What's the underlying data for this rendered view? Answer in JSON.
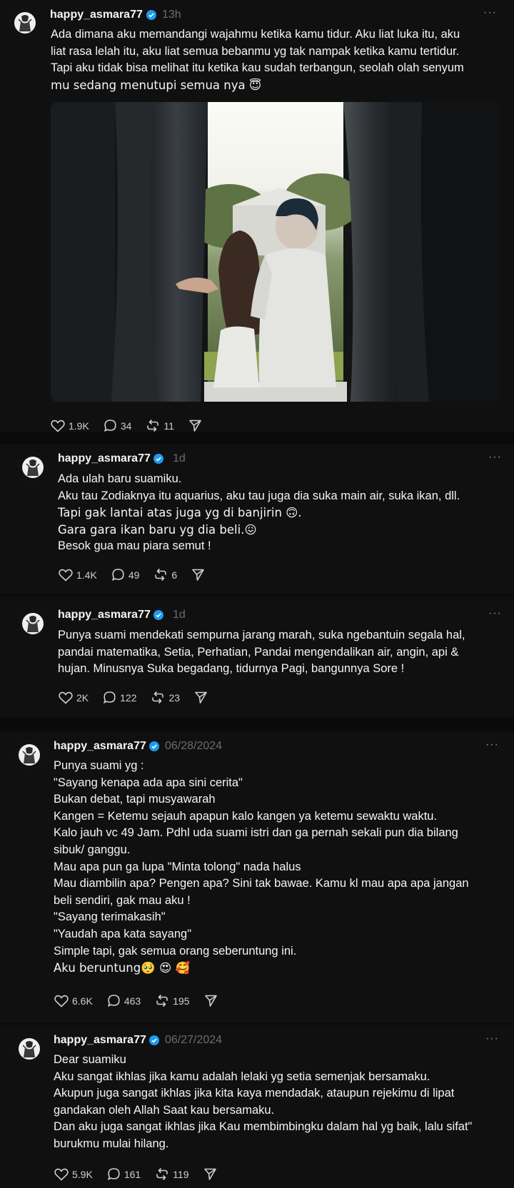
{
  "posts": [
    {
      "username": "happy_asmara77",
      "time": "13h",
      "more": "···",
      "lines": [
        "Ada dimana aku memandangi wajahmu ketika kamu tidur. Aku liat luka itu, aku",
        "liat rasa lelah itu, aku liat semua bebanmu yg tak nampak ketika kamu tertidur.",
        "Tapi aku tidak bisa melihat itu ketika kau sudah terbangun, seolah olah senyum",
        "mu sedang menutupi semua nya 😇"
      ],
      "likes": "1.9K",
      "comments": "34",
      "reposts": "11"
    },
    {
      "username": "happy_asmara77",
      "time": "1d",
      "more": "···",
      "lines": [
        "Ada ulah baru suamiku.",
        "Aku tau Zodiaknya itu aquarius, aku tau juga dia suka main air, suka ikan, dll.",
        "Tapi gak lantai atas juga yg di banjirin 🙃.",
        "Gara gara ikan baru yg dia beli.😖",
        "Besok gua mau piara semut !"
      ],
      "likes": "1.4K",
      "comments": "49",
      "reposts": "6"
    },
    {
      "username": "happy_asmara77",
      "time": "1d",
      "more": "···",
      "lines": [
        "Punya suami mendekati sempurna jarang marah, suka ngebantuin segala hal,",
        "pandai matematika, Setia, Perhatian, Pandai mengendalikan air, angin, api &",
        "hujan. Minusnya Suka begadang, tidurnya Pagi, bangunnya Sore !"
      ],
      "likes": "2K",
      "comments": "122",
      "reposts": "23"
    },
    {
      "username": "happy_asmara77",
      "time": "06/28/2024",
      "more": "···",
      "lines": [
        "Punya suami yg :",
        "\"Sayang kenapa ada apa sini cerita\"",
        "Bukan debat, tapi musyawarah",
        "Kangen = Ketemu sejauh apapun kalo kangen ya ketemu sewaktu waktu.",
        "Kalo jauh vc 49 Jam. Pdhl uda suami istri dan ga pernah sekali pun dia bilang",
        "sibuk/ ganggu.",
        "Mau apa pun ga lupa \"Minta tolong\" nada halus",
        "Mau diambilin apa? Pengen apa? Sini tak bawae. Kamu kl mau apa apa jangan",
        "beli sendiri, gak mau aku !",
        "\"Sayang terimakasih\"",
        "\"Yaudah apa kata sayang\"",
        "Simple tapi, gak semua orang seberuntung ini.",
        "Aku beruntung🥺 😍 🥰"
      ],
      "likes": "6.6K",
      "comments": "463",
      "reposts": "195"
    },
    {
      "username": "happy_asmara77",
      "time": "06/27/2024",
      "more": "···",
      "lines": [
        "Dear suamiku",
        "Aku sangat ikhlas jika kamu adalah lelaki yg setia semenjak bersamaku.",
        "Akupun juga sangat ikhlas jika kita kaya mendadak, ataupun rejekimu di lipat",
        "gandakan oleh Allah Saat kau bersamaku.",
        "Dan aku juga sangat ikhlas jika Kau membimbingku dalam hal yg baik, lalu sifat\"",
        "burukmu mulai hilang."
      ],
      "likes": "5.9K",
      "comments": "161",
      "reposts": "119"
    }
  ],
  "icons": [
    "heart-icon",
    "comment-icon",
    "repost-icon",
    "share-icon",
    "verified-icon"
  ],
  "colors": {
    "background": "#101010",
    "separator": "#0a0a0a",
    "verified": "#1d9bf0",
    "muted": "#6d6d6d"
  }
}
